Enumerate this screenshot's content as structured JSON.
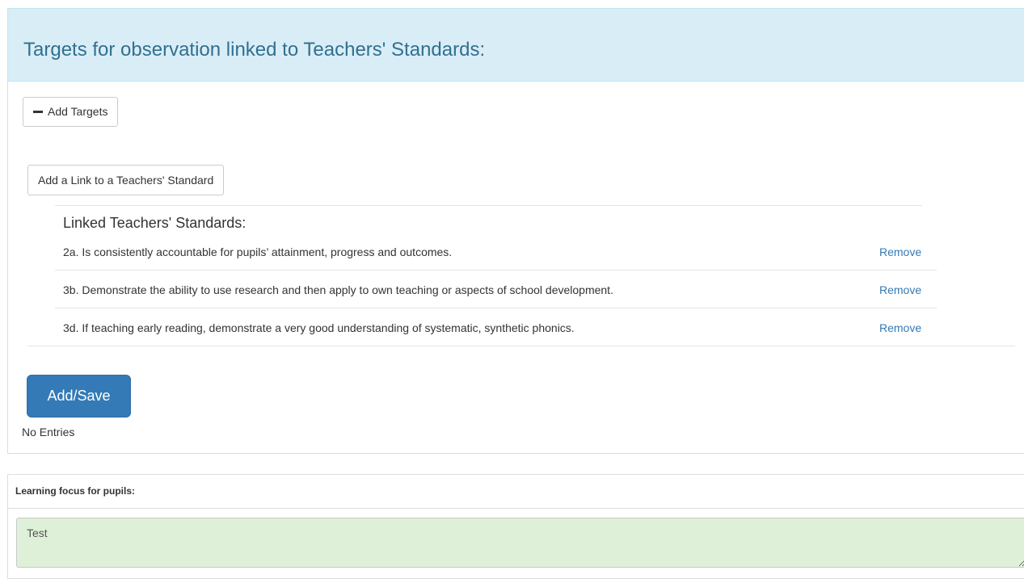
{
  "targets_panel": {
    "title": "Targets for observation linked to Teachers' Standards:",
    "add_targets_label": "Add Targets",
    "add_link_label": "Add a Link to a Teachers' Standard",
    "linked_heading": "Linked Teachers' Standards:",
    "standards": [
      {
        "text": "2a. Is consistently accountable for pupils’ attainment, progress and outcomes.",
        "action": "Remove"
      },
      {
        "text": "3b. Demonstrate the ability to use research and then apply to own teaching or aspects of school development.",
        "action": "Remove"
      },
      {
        "text": "3d. If teaching early reading, demonstrate a very good understanding of systematic, synthetic phonics.",
        "action": "Remove"
      }
    ],
    "save_label": "Add/Save",
    "no_entries": "No Entries"
  },
  "learning_focus": {
    "title": "Learning focus for pupils:",
    "value": "Test"
  },
  "colors": {
    "heading_bg": "#d9edf7",
    "heading_text": "#31708f",
    "primary": "#337ab7",
    "textarea_bg": "#dff0d8"
  }
}
